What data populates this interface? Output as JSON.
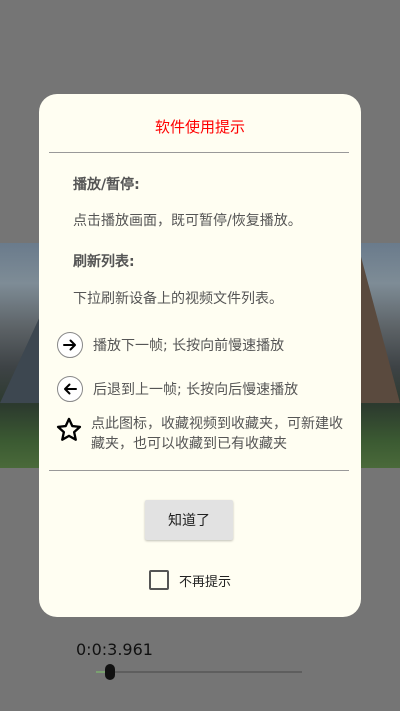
{
  "dialog": {
    "title": "软件使用提示",
    "sections": [
      {
        "heading": "播放/暂停:",
        "body": "点击播放画面，既可暂停/恢复播放。"
      },
      {
        "heading": "刷新列表:",
        "body": "下拉刷新设备上的视频文件列表。"
      }
    ],
    "icon_rows": [
      {
        "icon": "arrow-right-icon",
        "text": "播放下一帧; 长按向前慢速播放"
      },
      {
        "icon": "arrow-left-icon",
        "text": "后退到上一帧; 长按向后慢速播放"
      }
    ],
    "star_row": {
      "icon": "star-icon",
      "text": "点此图标，收藏视频到收藏夹，可新建收藏夹，也可以收藏到已有收藏夹"
    },
    "confirm_label": "知道了",
    "dont_show_label": "不再提示",
    "dont_show_checked": false
  },
  "player": {
    "time": "0:0:3.961",
    "progress": 0.07
  }
}
